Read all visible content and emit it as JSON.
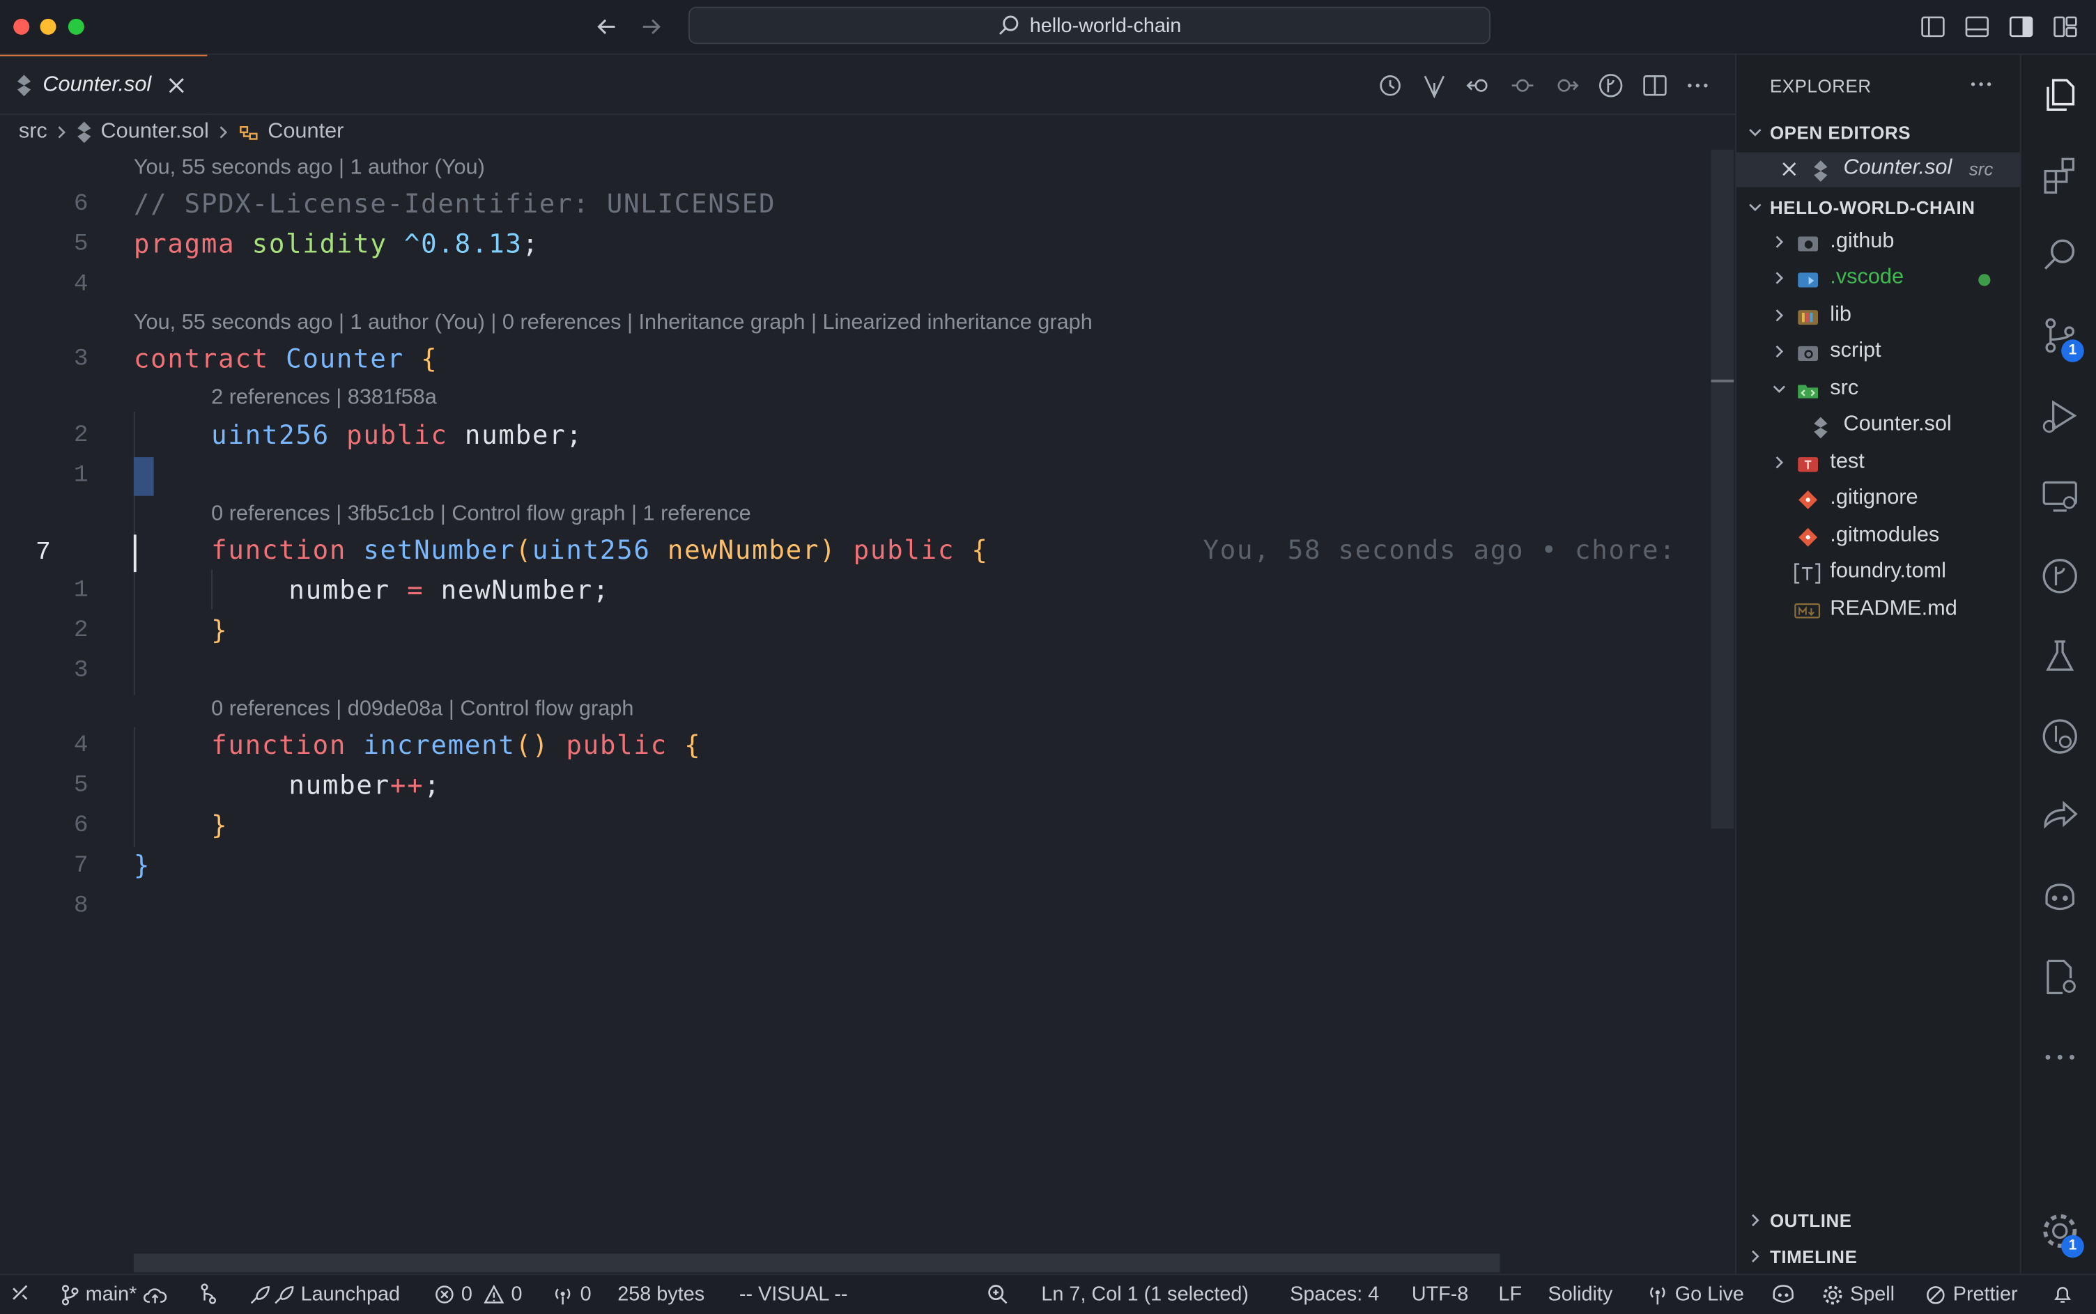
{
  "title_bar": {
    "command_center": "hello-world-chain"
  },
  "tab": {
    "label": "Counter.sol"
  },
  "breadcrumb": {
    "folder": "src",
    "file": "Counter.sol",
    "symbol": "Counter"
  },
  "editor": {
    "lens_1": "You, 55 seconds ago | 1 author (You)",
    "lens_2": "You, 55 seconds ago | 1 author (You) | 0 references | Inheritance graph | Linearized inheritance graph",
    "lens_3": "2 references | 8381f58a",
    "lens_4": "0 references | 3fb5c1cb | Control flow graph | 1 reference",
    "lens_5": "0 references | d09de08a | Control flow graph",
    "blame": "You, 58 seconds ago • chore:",
    "line_numbers": [
      "6",
      "5",
      "4",
      "3",
      "2",
      "1",
      "7",
      "1",
      "2",
      "3",
      "4",
      "5",
      "6",
      "7",
      "8"
    ],
    "lines": {
      "l1_comment": "// SPDX-License-Identifier: UNLICENSED",
      "l2_pragma": "pragma",
      "l2_solidity": "solidity",
      "l2_version": "^0.8.13",
      "l2_semi": ";",
      "l3_contract": "contract",
      "l3_name": "Counter",
      "l3_brace": "{",
      "l4_type": "uint256",
      "l4_public": "public",
      "l4_var": "number;",
      "l6_function": "function",
      "l6_name": "setNumber",
      "l6_open": "(",
      "l6_type": "uint256",
      "l6_param": "newNumber",
      "l6_close": ")",
      "l6_public": "public",
      "l6_brace": "{",
      "l7_lhs": "number",
      "l7_eq": "=",
      "l7_rhs": "newNumber;",
      "l8_brace": "}",
      "l10_function": "function",
      "l10_name": "increment",
      "l10_parens": "()",
      "l10_public": "public",
      "l10_brace": "{",
      "l11_var": "number",
      "l11_op": "++",
      "l11_semi": ";",
      "l12_brace": "}",
      "l13_brace": "}"
    }
  },
  "explorer": {
    "title": "EXPLORER",
    "open_editors": "OPEN EDITORS",
    "open_file": "Counter.sol",
    "open_file_folder": "src",
    "project": "HELLO-WORLD-CHAIN",
    "items": [
      {
        "label": ".github"
      },
      {
        "label": ".vscode"
      },
      {
        "label": "lib"
      },
      {
        "label": "script"
      },
      {
        "label": "src"
      },
      {
        "label": "Counter.sol"
      },
      {
        "label": "test"
      },
      {
        "label": ".gitignore"
      },
      {
        "label": ".gitmodules"
      },
      {
        "label": "foundry.toml"
      },
      {
        "label": "README.md"
      }
    ],
    "outline": "OUTLINE",
    "timeline": "TIMELINE"
  },
  "activity": {
    "scm_badge": "1",
    "settings_badge": "1"
  },
  "status": {
    "branch": "main*",
    "launchpad": "Launchpad",
    "errors": "0",
    "warnings": "0",
    "ports": "0",
    "size": "258 bytes",
    "mode": "-- VISUAL --",
    "position": "Ln 7, Col 1 (1 selected)",
    "spaces": "Spaces: 4",
    "encoding": "UTF-8",
    "eol": "LF",
    "language": "Solidity",
    "golive": "Go Live",
    "spell": "Spell",
    "prettier": "Prettier"
  },
  "colors": {
    "accent_tab": "#e07a3f",
    "badge": "#1f6feb",
    "vscode_folder": "#3fb950"
  }
}
